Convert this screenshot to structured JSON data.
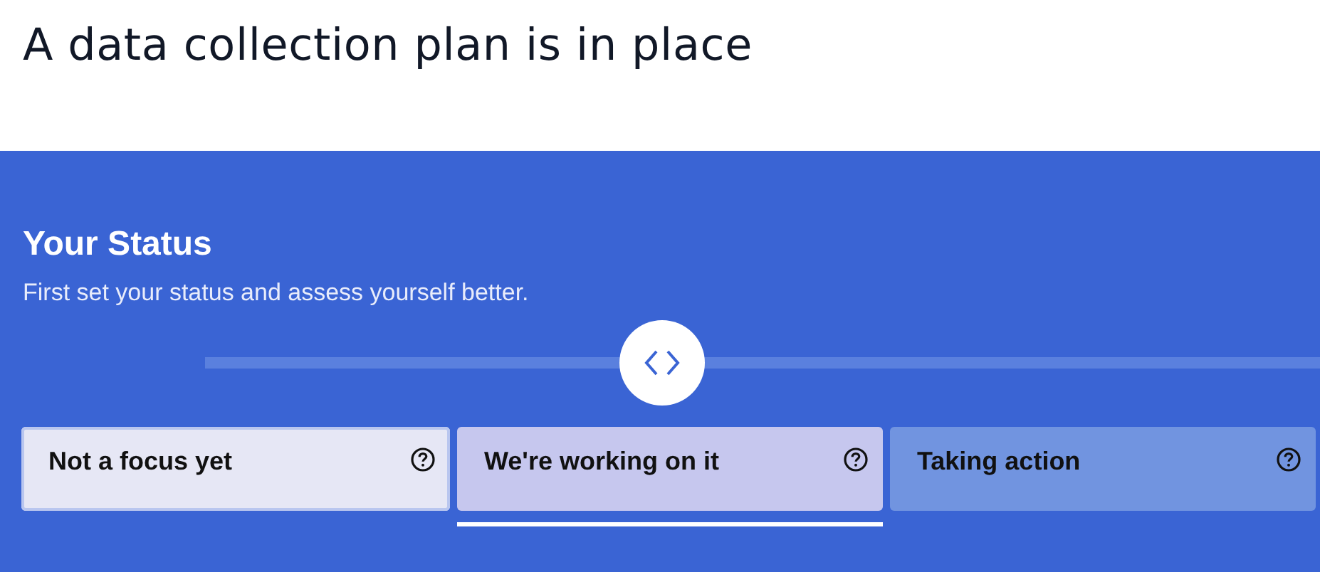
{
  "heading": "A data collection plan is in place",
  "status": {
    "title": "Your Status",
    "subtitle": "First set your status and assess yourself better.",
    "slider": {
      "level": 0.41
    },
    "options": [
      {
        "label": "Not a focus yet",
        "selected": false,
        "color": "#e6e7f5"
      },
      {
        "label": "We're working on it",
        "selected": true,
        "color": "#c6c7ee"
      },
      {
        "label": "Taking action",
        "selected": false,
        "color": "#7194e0"
      }
    ]
  }
}
